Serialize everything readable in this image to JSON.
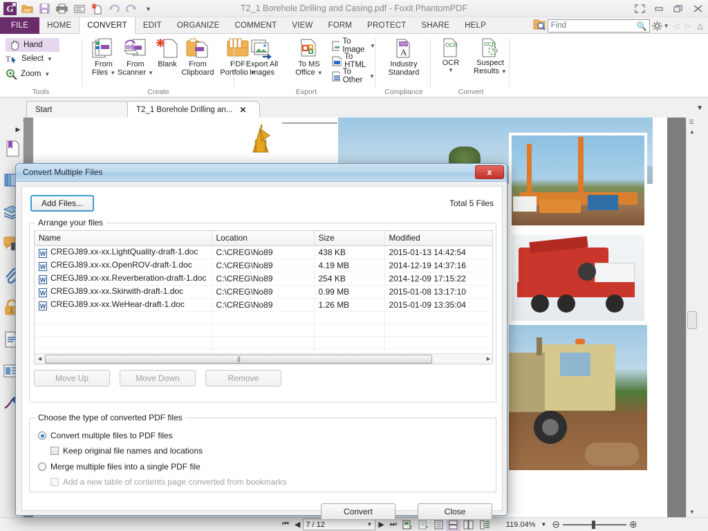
{
  "window": {
    "title": "T2_1 Borehole Drilling and Casing.pdf - Foxit PhantomPDF",
    "quick_access": [
      "app-logo",
      "open-icon",
      "save-icon",
      "print-icon",
      "email-icon",
      "new-from-file-icon",
      "undo-icon",
      "redo-icon",
      "customize-caret"
    ],
    "controls": [
      "restore-small-icon",
      "minimize-icon",
      "maximize-icon",
      "close-icon"
    ]
  },
  "ribbon_tabs": [
    {
      "label": "FILE",
      "state": "file"
    },
    {
      "label": "HOME",
      "state": "normal"
    },
    {
      "label": "CONVERT",
      "state": "active"
    },
    {
      "label": "EDIT",
      "state": "normal"
    },
    {
      "label": "ORGANIZE",
      "state": "normal"
    },
    {
      "label": "COMMENT",
      "state": "normal"
    },
    {
      "label": "VIEW",
      "state": "normal"
    },
    {
      "label": "FORM",
      "state": "normal"
    },
    {
      "label": "PROTECT",
      "state": "normal"
    },
    {
      "label": "SHARE",
      "state": "normal"
    },
    {
      "label": "HELP",
      "state": "normal"
    }
  ],
  "search": {
    "placeholder": "Find",
    "value": ""
  },
  "ribbon": {
    "groups": [
      {
        "name": "Tools",
        "label": "Tools"
      },
      {
        "name": "Create",
        "label": "Create"
      },
      {
        "name": "Export",
        "label": "Export"
      },
      {
        "name": "Compliance",
        "label": "Compliance"
      },
      {
        "name": "Convert",
        "label": "Convert"
      }
    ],
    "tools": [
      {
        "label": "Hand",
        "icon": "hand-icon",
        "selected": true
      },
      {
        "label": "Select",
        "icon": "select-text-icon",
        "caret": true
      },
      {
        "label": "Zoom",
        "icon": "zoom-magnifier-icon",
        "caret": true
      }
    ],
    "create": [
      {
        "label_line1": "From",
        "label_line2": "Files",
        "caret": true
      },
      {
        "label_line1": "From",
        "label_line2": "Scanner",
        "caret": true
      },
      {
        "label_line1": "Blank",
        "label_line2": "",
        "caret": false
      },
      {
        "label_line1": "From",
        "label_line2": "Clipboard",
        "caret": false
      },
      {
        "label_line1": "PDF",
        "label_line2": "Portfolio",
        "caret": true
      }
    ],
    "export": {
      "export_all": {
        "label_line1": "Export All",
        "label_line2": "Images"
      },
      "to_office": {
        "label_line1": "To MS",
        "label_line2": "Office",
        "caret": true
      },
      "small_items": [
        {
          "label": "To Image",
          "caret": true
        },
        {
          "label": "To HTML",
          "caret": false
        },
        {
          "label": "To Other",
          "caret": true
        }
      ]
    },
    "compliance": [
      {
        "label_line1": "Industry",
        "label_line2": "Standard"
      }
    ],
    "convert": [
      {
        "label_line1": "OCR",
        "label_line2": "",
        "caret": true
      },
      {
        "label_line1": "Suspect",
        "label_line2": "Results",
        "caret": true
      }
    ]
  },
  "doc_tabs": [
    {
      "label": "Start",
      "selected": false,
      "closable": false
    },
    {
      "label": "T2_1  Borehole Drilling an...",
      "selected": true,
      "closable": true
    }
  ],
  "rail_items": [
    {
      "name": "bookmarks-icon"
    },
    {
      "name": "page-thumbnails-icon"
    },
    {
      "name": "layers-icon"
    },
    {
      "name": "comments-icon"
    },
    {
      "name": "attachments-icon"
    },
    {
      "name": "security-lock-icon"
    },
    {
      "name": "destinations-icon"
    },
    {
      "name": "fields-icon"
    },
    {
      "name": "signatures-icon"
    }
  ],
  "dialog": {
    "title": "Convert Multiple Files",
    "close_label": "x",
    "add_files_label": "Add Files...",
    "total_files_label": "Total 5 Files",
    "arrange_legend": "Arrange your files",
    "columns": [
      "Name",
      "Location",
      "Size",
      "Modified"
    ],
    "rows": [
      {
        "name": "CREGJ89.xx-xx.LightQuality-draft-1.doc",
        "location": "C:\\CREG\\No89",
        "size": "438 KB",
        "modified": "2015-01-13 14:42:54"
      },
      {
        "name": "CREGJ89.xx-xx.OpenROV-draft-1.doc",
        "location": "C:\\CREG\\No89",
        "size": "4.19 MB",
        "modified": "2014-12-19 14:37:16"
      },
      {
        "name": "CREGJ89.xx-xx.Reverberation-draft-1.doc",
        "location": "C:\\CREG\\No89",
        "size": "254 KB",
        "modified": "2014-12-09 17:15:22"
      },
      {
        "name": "CREGJ89.xx-xx.Skirwith-draft-1.doc",
        "location": "C:\\CREG\\No89",
        "size": "0.99 MB",
        "modified": "2015-01-08 13:17:10"
      },
      {
        "name": "CREGJ89.xx-xx.WeHear-draft-1.doc",
        "location": "C:\\CREG\\No89",
        "size": "1.26 MB",
        "modified": "2015-01-09 13:35:04"
      }
    ],
    "list_buttons": [
      {
        "label": "Move Up",
        "enabled": false
      },
      {
        "label": "Move Down",
        "enabled": false
      },
      {
        "label": "Remove",
        "enabled": false
      }
    ],
    "type_legend": "Choose the type of converted PDF files",
    "options": [
      {
        "label": "Convert multiple files to PDF files",
        "type": "radio",
        "checked": true,
        "enabled": true
      },
      {
        "label": "Keep original file names and locations",
        "type": "checkbox",
        "checked": false,
        "enabled": true
      },
      {
        "label": "Merge multiple files into a single PDF file",
        "type": "radio",
        "checked": false,
        "enabled": true
      },
      {
        "label": "Add a new table of contents page converted from bookmarks",
        "type": "checkbox",
        "checked": false,
        "enabled": false
      }
    ],
    "convert_label": "Convert",
    "close_button_label": "Close"
  },
  "statusbar": {
    "page_value": "7 / 12",
    "zoom_value": "119.04%",
    "nav_icons": [
      "first-page-icon",
      "previous-page-icon",
      "next-page-icon",
      "last-page-icon"
    ],
    "view_icons": [
      "fit-page-icon",
      "fit-width-icon",
      "single-page-icon",
      "continuous-page-icon",
      "facing-page-icon",
      "continuous-facing-icon"
    ],
    "zoom_out_label": "−",
    "zoom_in_label": "+"
  }
}
